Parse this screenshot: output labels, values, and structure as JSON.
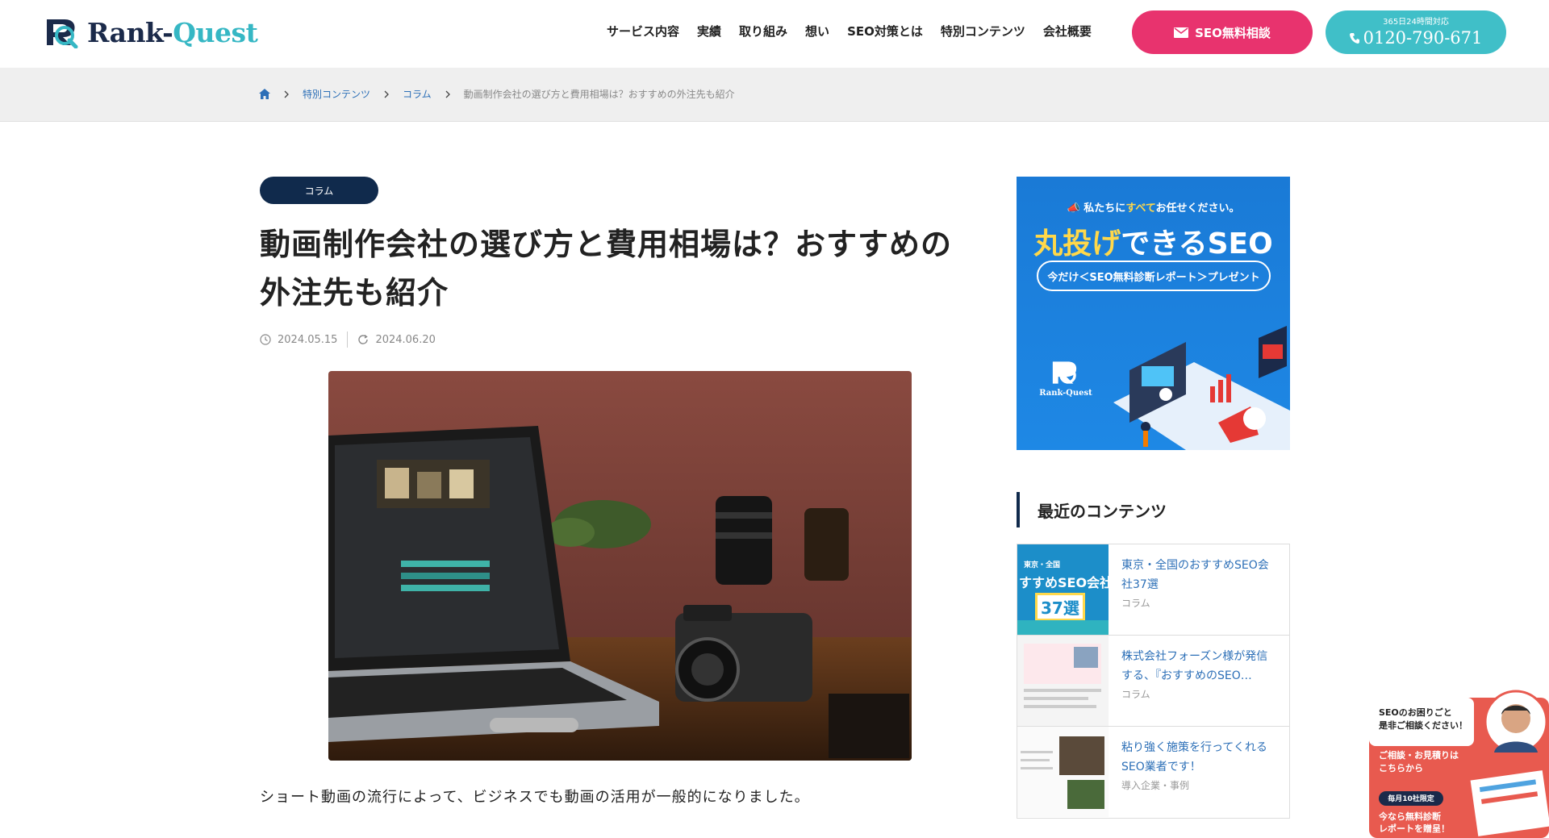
{
  "header": {
    "logo_text_part1": "Rank-",
    "logo_text_part2": "Quest",
    "nav": [
      "サービス内容",
      "実績",
      "取り組み",
      "想い",
      "SEO対策とは",
      "特別コンテンツ",
      "会社概要"
    ],
    "cta_mail_label": "SEO無料相談",
    "cta_tel_note": "365日24時間対応",
    "cta_tel_number": "0120-790-671",
    "brand_colors": {
      "navy": "#102a4c",
      "teal": "#40bfc8",
      "pink": "#e8336e"
    }
  },
  "breadcrumb": {
    "home_icon": "home-icon",
    "items": [
      "特別コンテンツ",
      "コラム"
    ],
    "current": "動画制作会社の選び方と費用相場は？おすすめの外注先も紹介"
  },
  "article": {
    "category": "コラム",
    "title_line1": "動画制作会社の選び方と費用相場は？おすすめの",
    "title_line2": "外注先も紹介",
    "published": "2024.05.15",
    "updated": "2024.06.20",
    "lead": "ショート動画の流行によって、ビジネスでも動画の活用が一般的になりました。"
  },
  "sidebar": {
    "ad": {
      "sub_pre": "私たちに",
      "sub_hl": "すべて",
      "sub_post": "お任せください。",
      "main_hl": "丸投げ",
      "main_post": "できるSEO",
      "pill": "今だけ＜SEO無料診断レポート＞プレゼント",
      "logo_text": "Rank-Quest"
    },
    "recent_heading": "最近のコンテンツ",
    "recent": [
      {
        "title": "東京・全国のおすすめSEO会社37選",
        "category": "コラム",
        "thumb_line1": "東京・全国",
        "thumb_line2": "すすめSEO会社",
        "thumb_line3": "37選"
      },
      {
        "title": "株式会社フォーズン様が発信する、『おすすめのSEO…",
        "category": "コラム"
      },
      {
        "title": "粘り強く施策を行ってくれるSEO業者です！",
        "category": "導入企業・事例"
      }
    ]
  },
  "consult_widget": {
    "line1": "SEOのお困りごと",
    "line2": "是非ご相談ください！",
    "line3": "ご相談・お見積りは",
    "line4": "こちらから",
    "badge": "毎月10社限定",
    "line5": "今なら無料診断",
    "line6": "レポートを贈呈！"
  }
}
